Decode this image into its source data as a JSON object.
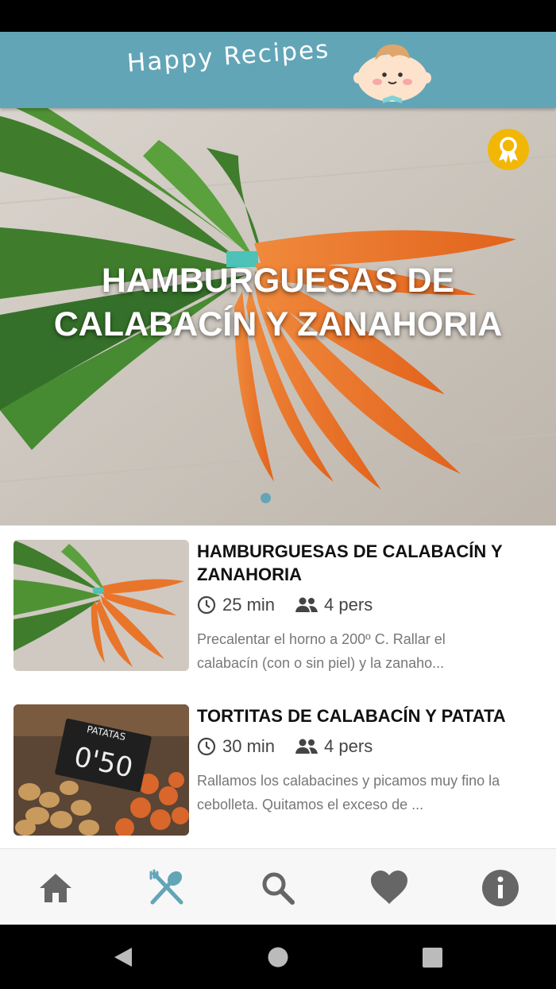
{
  "header": {
    "app_name": "Happy Recipes",
    "brand_color": "#62a5b7",
    "mascot": "baby-face"
  },
  "hero": {
    "title_line1": "HAMBURGUESAS DE",
    "title_line2": "CALABACÍN Y ZANAHORIA",
    "badge_icon": "award-ribbon-icon",
    "badge_color": "#f2b705",
    "carousel_active_index": 1
  },
  "recipes": [
    {
      "title_line1": "HAMBURGUESAS DE CALABACÍN Y",
      "title_line2": "ZANAHORIA",
      "time": "25 min",
      "people": "4 pers",
      "desc_line1": "Precalentar el horno a 200º C. Rallar el",
      "desc_line2": "calabacín (con o sin piel) y la zanaho..."
    },
    {
      "title_line1": "TORTITAS DE CALABACÍN Y PATATA",
      "time": "30 min",
      "people": "4 pers",
      "desc_line1": "Rallamos los calabacines y picamos muy fino la",
      "desc_line2": "cebolleta. Quitamos el exceso de ...",
      "thumb_sign_top": "PATATAS",
      "thumb_sign_price": "0'50"
    }
  ],
  "bottom_nav": {
    "items": [
      "home-icon",
      "recipes-icon",
      "search-icon",
      "favorites-icon",
      "info-icon"
    ],
    "active_index": 1
  },
  "system_nav": [
    "back-icon",
    "home-circle-icon",
    "recents-icon"
  ]
}
